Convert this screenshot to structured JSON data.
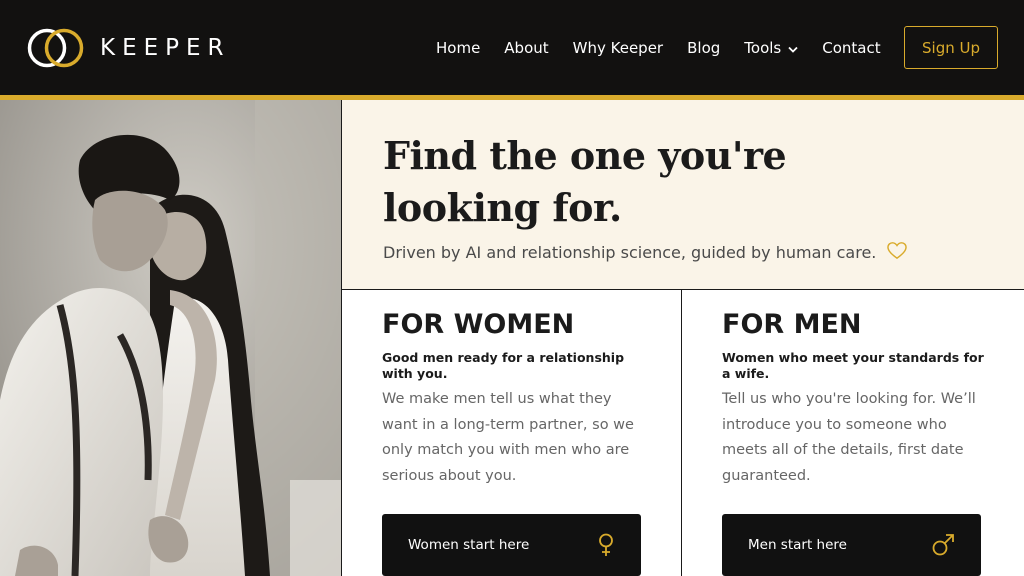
{
  "brand": {
    "name": "KEEPER",
    "accent": "#d9ab2c"
  },
  "nav": {
    "items": [
      {
        "label": "Home"
      },
      {
        "label": "About"
      },
      {
        "label": "Why Keeper"
      },
      {
        "label": "Blog"
      },
      {
        "label": "Tools",
        "icon": "chevron-down-icon"
      },
      {
        "label": "Contact"
      }
    ],
    "signup_label": "Sign Up"
  },
  "hero": {
    "title": "Find the one you're looking for.",
    "subtitle": "Driven by AI and relationship science, guided by human care.",
    "subtitle_icon": "heart-outline-icon"
  },
  "cards": {
    "women": {
      "title": "FOR WOMEN",
      "lead": "Good men ready for a relationship with you.",
      "body": "We make men tell us what they want in a long-term partner, so we only match you with men who are serious about you.",
      "cta_label": "Women start here",
      "cta_icon": "female-symbol-icon"
    },
    "men": {
      "title": "FOR MEN",
      "lead": "Women who meet your standards for a wife.",
      "body": "Tell us who you're looking for. We’ll introduce you to someone who meets all of the details, first date guaranteed.",
      "cta_label": "Men start here",
      "cta_icon": "male-symbol-icon"
    }
  }
}
